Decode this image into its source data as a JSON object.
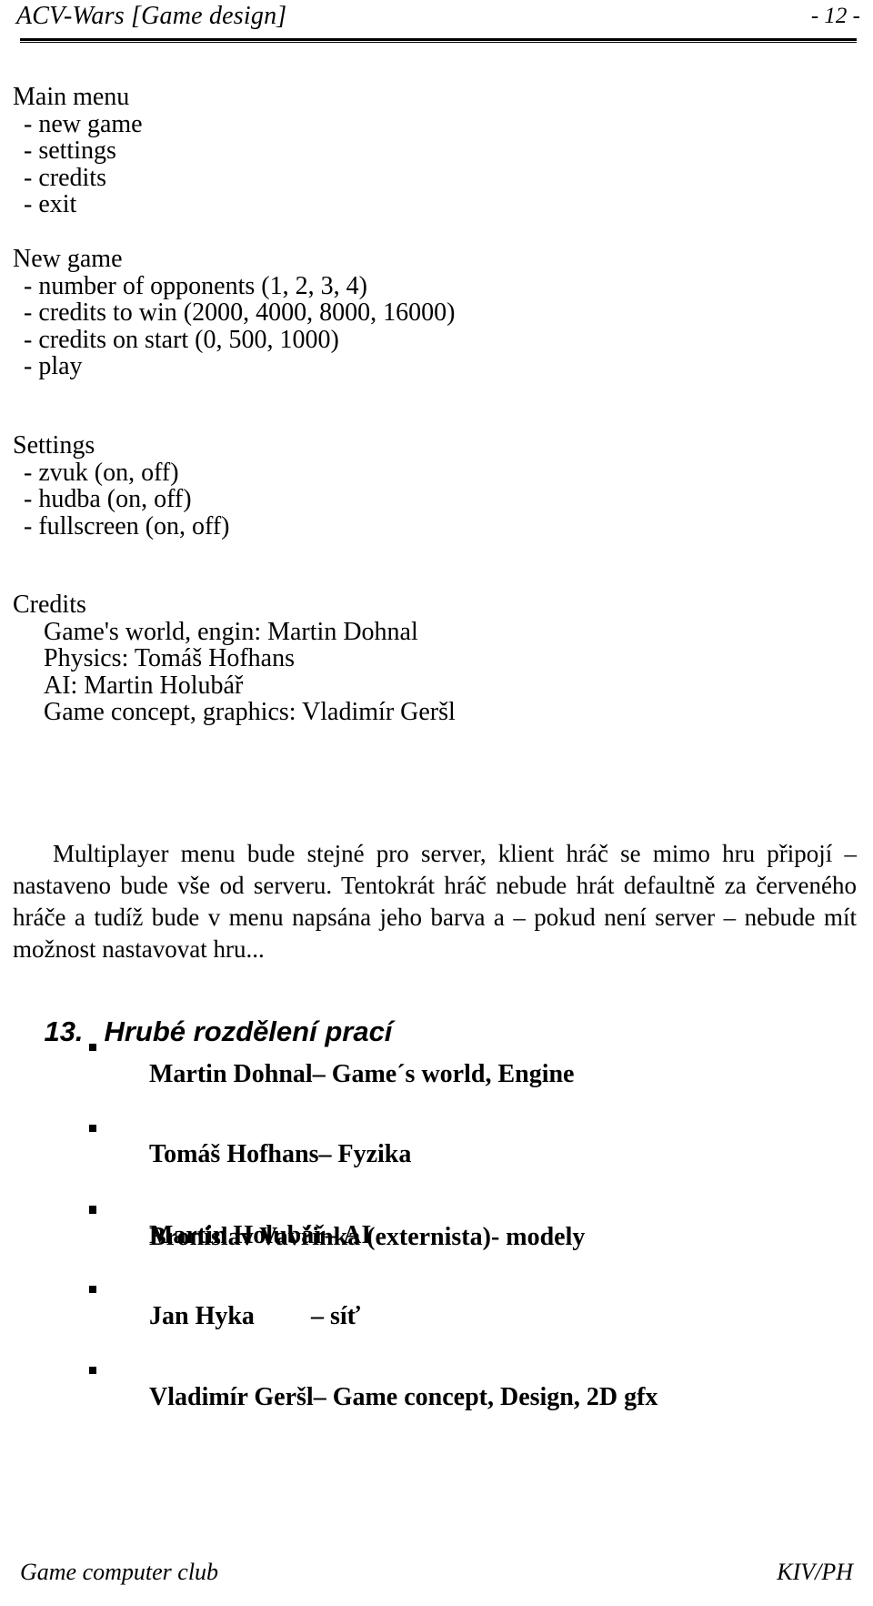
{
  "header": {
    "title": "ACV-Wars [Game design]",
    "page_label": "- 12 -"
  },
  "sections": {
    "main_menu": {
      "heading": "Main menu",
      "items": [
        "- new game",
        "- settings",
        "- credits",
        "- exit"
      ]
    },
    "new_game": {
      "heading": "New game",
      "items": [
        "- number of opponents (1, 2, 3, 4)",
        "- credits to win (2000, 4000, 8000, 16000)",
        "- credits on start (0, 500, 1000)",
        "- play"
      ]
    },
    "settings": {
      "heading": "Settings",
      "items": [
        "- zvuk (on, off)",
        "- hudba (on, off)",
        "- fullscreen (on, off)"
      ]
    },
    "credits": {
      "heading": "Credits",
      "items": [
        "Game's world, engin: Martin Dohnal",
        "Physics: Tomáš Hofhans",
        "AI: Martin Holubář",
        "Game concept, graphics: Vladimír Geršl"
      ]
    }
  },
  "paragraph": {
    "lines": [
      "Multiplayer menu bude stejné pro server, klient hráč se mimo hru připojí –",
      "nastaveno bude vše od serveru. Tentokrát hráč nebude hrát defaultně za červeného",
      "hráče a tudíž bude v menu napsána jeho barva a – pokud není server – nebude mít",
      "možnost nastavovat hru..."
    ]
  },
  "section13": {
    "number": "13.",
    "title": "Hrubé rozdělení prací",
    "rows": [
      {
        "who": "Martin Dohnal",
        "what": "– Game´s world, Engine"
      },
      {
        "who": "Tomáš Hofhans",
        "what": "– Fyzika"
      },
      {
        "who": "Martin Holubář",
        "what": "– AI"
      },
      {
        "who": "Jan Hyka",
        "what": "– síť"
      },
      {
        "who": "Vladimír Geršl",
        "what": "– Game concept, Design, 2D gfx"
      }
    ],
    "extra_row": {
      "who": "Bronislav Vavřinka (externista)",
      "what": "- modely"
    }
  },
  "footer": {
    "left": "Game computer club",
    "right": "KIV/PH"
  }
}
